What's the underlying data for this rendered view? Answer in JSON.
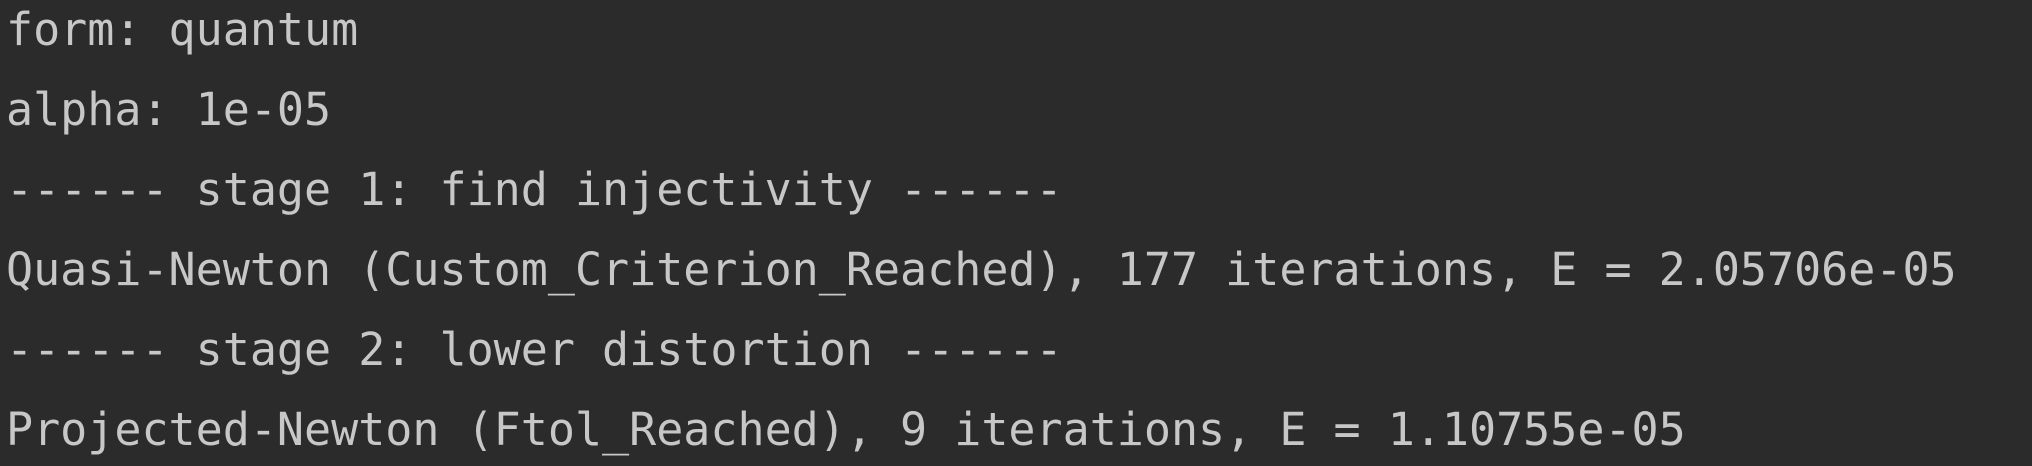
{
  "console": {
    "lines": [
      "form: quantum",
      "alpha: 1e-05",
      "------ stage 1: find injectivity ------",
      "Quasi-Newton (Custom_Criterion_Reached), 177 iterations, E = 2.05706e-05",
      "------ stage 2: lower distortion ------",
      "Projected-Newton (Ftol_Reached), 9 iterations, E = 1.10755e-05"
    ]
  },
  "colors": {
    "background": "#2b2b2b",
    "text": "#c7c7c7"
  }
}
